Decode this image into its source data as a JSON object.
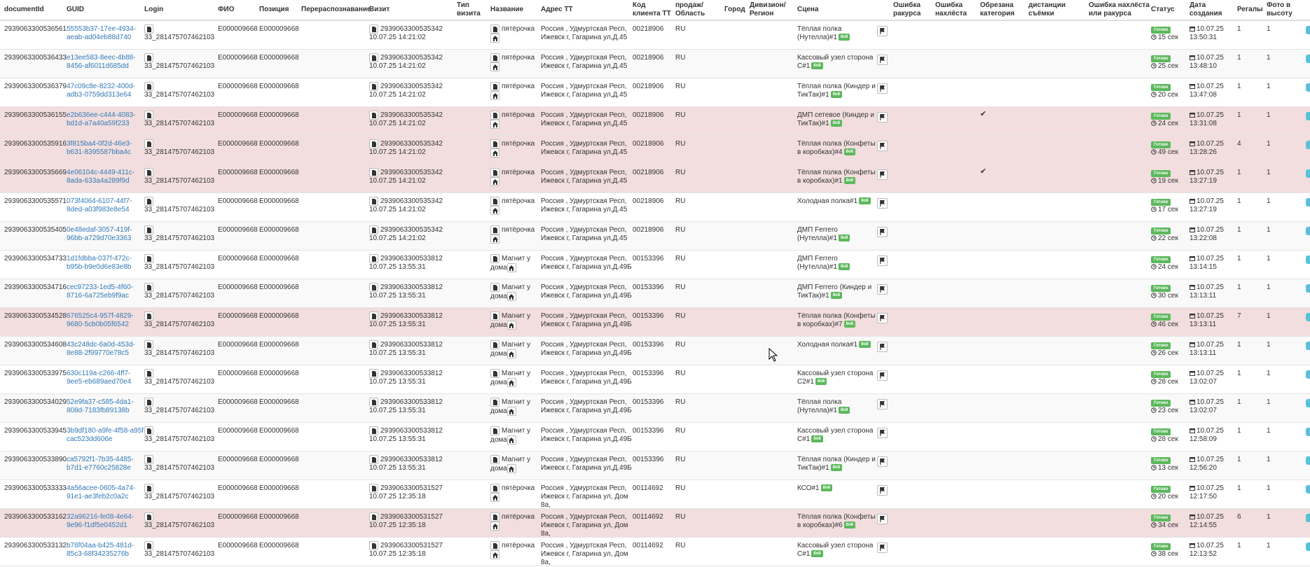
{
  "columns": [
    "documentId",
    "GUID",
    "Login",
    "ФИО",
    "Позиция",
    "Перераспознавание",
    "Визит",
    "Тип визита",
    "Название",
    "Адрес ТТ",
    "Код клиента ТТ",
    "продаж/ Область",
    "Город",
    "Дивизион/ Регион",
    "Сцена",
    "Ошибка ракурса",
    "Ошибка нахлёста",
    "Обрезана категория",
    "дистанции съёмки",
    "Ошибка нахлёста или ракурса",
    "Статус",
    "Дата создания",
    "Регалы",
    "Фото в высоту"
  ],
  "column_header_lines": {
    "Тип визита": [
      "Тип",
      "визита"
    ],
    "Код клиента ТТ": [
      "Код",
      "клиента ТТ"
    ],
    "продаж/ Область": [
      "продаж/",
      "Область"
    ],
    "Дивизион/ Регион": [
      "Дивизион/",
      "Регион"
    ],
    "Ошибка ракурса": [
      "Ошибка",
      "ракурса"
    ],
    "Ошибка нахлёста": [
      "Ошибка",
      "нахлёста"
    ],
    "Обрезана категория": [
      "Обрезана",
      "категория"
    ],
    "дистанции съёмки": [
      "дистанции",
      "съёмки"
    ],
    "Ошибка нахлёста или ракурса": [
      "Ошибка нахлёста",
      "или ракурса"
    ],
    "Дата создания": [
      "Дата",
      "создания"
    ],
    "Фото в высоту": [
      "Фото в",
      "высоту"
    ]
  },
  "badge_text": "8о8",
  "status_text": "Готово",
  "colors": {
    "link": "#337ab7",
    "highlight": "#f2dede",
    "badge": "#5cb85c",
    "edge": "#5bc0de"
  },
  "icons": {
    "file": "file-icon",
    "home": "home-icon",
    "flag": "flag-icon",
    "clock": "clock-icon",
    "calendar": "calendar-icon",
    "check": "check-icon"
  },
  "rows": [
    {
      "doc": "2939063300536561",
      "guid1": "55553b37-17ee-4934-",
      "guid2": "aeab-ad04eb88d740",
      "login": "33_281475707462103",
      "fio": "E000009668",
      "pos": "E000009668",
      "visit_id": "2939063300535342",
      "visit_dt": "10.07.25 14:21:02",
      "store": "пятёрочка",
      "store2": "",
      "addr1": "Россия , Удмуртская Респ,",
      "addr2": "Ижевск г, Гагарина ул,Д.45",
      "addr3": "",
      "code": "00218906",
      "region": "RU",
      "scene1": "Тёплая полка",
      "scene2": "(Нутелла)#1",
      "sec": "15 сек",
      "date": "10.07.25",
      "time": "13:50:31",
      "regaly": "1",
      "photo": "1",
      "hl": false,
      "check": false
    },
    {
      "doc": "2939063300536433",
      "guid1": "e13ee583-8eec-4b88-",
      "guid2": "8456-af6011d685dd",
      "login": "33_281475707462103",
      "fio": "E000009668",
      "pos": "E000009668",
      "visit_id": "2939063300535342",
      "visit_dt": "10.07.25 14:21:02",
      "store": "пятёрочка",
      "store2": "",
      "addr1": "Россия , Удмуртская Респ,",
      "addr2": "Ижевск г, Гагарина ул,Д.45",
      "addr3": "",
      "code": "00218906",
      "region": "RU",
      "scene1": "Кассовый узел сторона",
      "scene2": "С#1",
      "sec": "25 сек",
      "date": "10.07.25",
      "time": "13:48:10",
      "regaly": "1",
      "photo": "1",
      "hl": false,
      "check": false
    },
    {
      "doc": "2939063300536379",
      "guid1": "47c09c8e-8232-400d-",
      "guid2": "adb3-0759dd313e64",
      "login": "33_281475707462103",
      "fio": "E000009668",
      "pos": "E000009668",
      "visit_id": "2939063300535342",
      "visit_dt": "10.07.25 14:21:02",
      "store": "пятёрочка",
      "store2": "",
      "addr1": "Россия , Удмуртская Респ,",
      "addr2": "Ижевск г, Гагарина ул,Д.45",
      "addr3": "",
      "code": "00218906",
      "region": "RU",
      "scene1": "Тёплая полка (Киндер и",
      "scene2": "ТикТак)#1",
      "sec": "20 сек",
      "date": "10.07.25",
      "time": "13:47:08",
      "regaly": "1",
      "photo": "1",
      "hl": false,
      "check": false
    },
    {
      "doc": "2939063300536155",
      "guid1": "e2b636ee-c444-4083-",
      "guid2": "bd1d-a7a40a59f233",
      "login": "33_281475707462103",
      "fio": "E000009668",
      "pos": "E000009668",
      "visit_id": "2939063300535342",
      "visit_dt": "10.07.25 14:21:02",
      "store": "пятёрочка",
      "store2": "",
      "addr1": "Россия , Удмуртская Респ,",
      "addr2": "Ижевск г, Гагарина ул,Д.45",
      "addr3": "",
      "code": "00218906",
      "region": "RU",
      "scene1": "ДМП сетевое (Киндер и",
      "scene2": "ТикТак)#1",
      "sec": "24 сек",
      "date": "10.07.25",
      "time": "13:31:08",
      "regaly": "1",
      "photo": "1",
      "hl": true,
      "check": true
    },
    {
      "doc": "2939063300535916",
      "guid1": "3f815ba4-0f2d-46e3-",
      "guid2": "b631-8395587bba4c",
      "login": "33_281475707462103",
      "fio": "E000009668",
      "pos": "E000009668",
      "visit_id": "2939063300535342",
      "visit_dt": "10.07.25 14:21:02",
      "store": "пятёрочка",
      "store2": "",
      "addr1": "Россия , Удмуртская Респ,",
      "addr2": "Ижевск г, Гагарина ул,Д.45",
      "addr3": "",
      "code": "00218906",
      "region": "RU",
      "scene1": "Тёплая полка (Конфеты",
      "scene2": "в коробках)#4",
      "sec": "49 сек",
      "date": "10.07.25",
      "time": "13:28:26",
      "regaly": "4",
      "photo": "1",
      "hl": true,
      "check": false
    },
    {
      "doc": "2939063300535669",
      "guid1": "4e06104c-4449-411c-",
      "guid2": "8ada-633a4a289f9d",
      "login": "33_281475707462103",
      "fio": "E000009668",
      "pos": "E000009668",
      "visit_id": "2939063300535342",
      "visit_dt": "10.07.25 14:21:02",
      "store": "пятёрочка",
      "store2": "",
      "addr1": "Россия , Удмуртская Респ,",
      "addr2": "Ижевск г, Гагарина ул,Д.45",
      "addr3": "",
      "code": "00218906",
      "region": "RU",
      "scene1": "Тёплая полка (Конфеты",
      "scene2": "в коробках)#1",
      "sec": "19 сек",
      "date": "10.07.25",
      "time": "13:27:19",
      "regaly": "1",
      "photo": "1",
      "hl": true,
      "check": true
    },
    {
      "doc": "2939063300535571",
      "guid1": "073f4064-6107-44f7-",
      "guid2": "8ded-a03f983e8e54",
      "login": "33_281475707462103",
      "fio": "E000009668",
      "pos": "E000009668",
      "visit_id": "2939063300535342",
      "visit_dt": "10.07.25 14:21:02",
      "store": "пятёрочка",
      "store2": "",
      "addr1": "Россия , Удмуртская Респ,",
      "addr2": "Ижевск г, Гагарина ул,Д.45",
      "addr3": "",
      "code": "00218906",
      "region": "RU",
      "scene1": "Холодная полка#1",
      "scene2": "",
      "sec": "17 сек",
      "date": "10.07.25",
      "time": "13:27:19",
      "regaly": "1",
      "photo": "1",
      "hl": false,
      "check": false
    },
    {
      "doc": "2939063300535405",
      "guid1": "0e48edaf-3057-419f-",
      "guid2": "96bb-a729d70e3363",
      "login": "33_281475707462103",
      "fio": "E000009668",
      "pos": "E000009668",
      "visit_id": "2939063300535342",
      "visit_dt": "10.07.25 14:21:02",
      "store": "пятёрочка",
      "store2": "",
      "addr1": "Россия , Удмуртская Респ,",
      "addr2": "Ижевск г, Гагарина ул,Д.45",
      "addr3": "",
      "code": "00218906",
      "region": "RU",
      "scene1": "ДМП Ferrero",
      "scene2": "(Нутелла)#1",
      "sec": "22 сек",
      "date": "10.07.25",
      "time": "13:22:08",
      "regaly": "1",
      "photo": "1",
      "hl": false,
      "check": false
    },
    {
      "doc": "2939063300534733",
      "guid1": "1d1fdbba-037f-472c-",
      "guid2": "b95b-b9e0d6e83e8b",
      "login": "33_281475707462103",
      "fio": "E000009668",
      "pos": "E000009668",
      "visit_id": "2939063300533812",
      "visit_dt": "10.07.25 13:55:31",
      "store": "Магнит у",
      "store2": "дома",
      "addr1": "Россия , Удмуртская Респ,",
      "addr2": "Ижевск г, Гагарина ул,Д.49Б",
      "addr3": "",
      "code": "00153396",
      "region": "RU",
      "scene1": "ДМП Ferrero",
      "scene2": "(Нутелла)#1",
      "sec": "24 сек",
      "date": "10.07.25",
      "time": "13:14:15",
      "regaly": "1",
      "photo": "1",
      "hl": false,
      "check": false
    },
    {
      "doc": "2939063300534716",
      "guid1": "cec97233-1ed5-4f60-",
      "guid2": "8716-6a725eb9f9ac",
      "login": "33_281475707462103",
      "fio": "E000009668",
      "pos": "E000009668",
      "visit_id": "2939063300533812",
      "visit_dt": "10.07.25 13:55:31",
      "store": "Магнит у",
      "store2": "дома",
      "addr1": "Россия , Удмуртская Респ,",
      "addr2": "Ижевск г, Гагарина ул,Д.49Б",
      "addr3": "",
      "code": "00153396",
      "region": "RU",
      "scene1": "ДМП Ferrero (Киндер и",
      "scene2": "ТикТак)#1",
      "sec": "30 сек",
      "date": "10.07.25",
      "time": "13:13:11",
      "regaly": "1",
      "photo": "1",
      "hl": false,
      "check": false
    },
    {
      "doc": "2939063300534528",
      "guid1": "676525c4-957f-4829-",
      "guid2": "9680-5cb0b05f6542",
      "login": "33_281475707462103",
      "fio": "E000009668",
      "pos": "E000009668",
      "visit_id": "2939063300533812",
      "visit_dt": "10.07.25 13:55:31",
      "store": "Магнит у",
      "store2": "дома",
      "addr1": "Россия , Удмуртская Респ,",
      "addr2": "Ижевск г, Гагарина ул,Д.49Б",
      "addr3": "",
      "code": "00153396",
      "region": "RU",
      "scene1": "Тёплая полка (Конфеты",
      "scene2": "в коробках)#7",
      "sec": "46 сек",
      "date": "10.07.25",
      "time": "13:13:11",
      "regaly": "7",
      "photo": "1",
      "hl": true,
      "check": false
    },
    {
      "doc": "2939063300534608",
      "guid1": "43c248dc-6a0d-453d-",
      "guid2": "8e88-2f99770e78c5",
      "login": "33_281475707462103",
      "fio": "E000009668",
      "pos": "E000009668",
      "visit_id": "2939063300533812",
      "visit_dt": "10.07.25 13:55:31",
      "store": "Магнит у",
      "store2": "дома",
      "addr1": "Россия , Удмуртская Респ,",
      "addr2": "Ижевск г, Гагарина ул,Д.49Б",
      "addr3": "",
      "code": "00153396",
      "region": "RU",
      "scene1": "Холодная полка#1",
      "scene2": "",
      "sec": "26 сек",
      "date": "10.07.25",
      "time": "13:13:11",
      "regaly": "1",
      "photo": "1",
      "hl": false,
      "check": false
    },
    {
      "doc": "2939063300533975",
      "guid1": "630c119a-c266-4ff7-",
      "guid2": "9ee5-eb689aed70e4",
      "login": "33_281475707462103",
      "fio": "E000009668",
      "pos": "E000009668",
      "visit_id": "2939063300533812",
      "visit_dt": "10.07.25 13:55:31",
      "store": "Магнит у",
      "store2": "дома",
      "addr1": "Россия , Удмуртская Респ,",
      "addr2": "Ижевск г, Гагарина ул,Д.49Б",
      "addr3": "",
      "code": "00153396",
      "region": "RU",
      "scene1": "Кассовый узел сторона",
      "scene2": "С2#1",
      "sec": "28 сек",
      "date": "10.07.25",
      "time": "13:02:07",
      "regaly": "1",
      "photo": "1",
      "hl": false,
      "check": false
    },
    {
      "doc": "2939063300534029",
      "guid1": "52e9fa37-c585-4da1-",
      "guid2": "808d-7183fb89138b",
      "login": "33_281475707462103",
      "fio": "E000009668",
      "pos": "E000009668",
      "visit_id": "2939063300533812",
      "visit_dt": "10.07.25 13:55:31",
      "store": "Магнит у",
      "store2": "дома",
      "addr1": "Россия , Удмуртская Респ,",
      "addr2": "Ижевск г, Гагарина ул,Д.49Б",
      "addr3": "",
      "code": "00153396",
      "region": "RU",
      "scene1": "Тёплая полка",
      "scene2": "(Нутелла)#1",
      "sec": "23 сек",
      "date": "10.07.25",
      "time": "13:02:07",
      "regaly": "1",
      "photo": "1",
      "hl": false,
      "check": false
    },
    {
      "doc": "2939063300533945",
      "guid1": "3b9df180-a9fe-4f58-a95f-",
      "guid2": "cac523dd606e",
      "login": "33_281475707462103",
      "fio": "E000009668",
      "pos": "E000009668",
      "visit_id": "2939063300533812",
      "visit_dt": "10.07.25 13:55:31",
      "store": "Магнит у",
      "store2": "дома",
      "addr1": "Россия , Удмуртская Респ,",
      "addr2": "Ижевск г, Гагарина ул,Д.49Б",
      "addr3": "",
      "code": "00153396",
      "region": "RU",
      "scene1": "Кассовый узел сторона",
      "scene2": "С#1",
      "sec": "28 сек",
      "date": "10.07.25",
      "time": "12:58:09",
      "regaly": "1",
      "photo": "1",
      "hl": false,
      "check": false
    },
    {
      "doc": "2939063300533890",
      "guid1": "ca5792f1-7b35-4485-",
      "guid2": "b7d1-e7760c25828e",
      "login": "33_281475707462103",
      "fio": "E000009668",
      "pos": "E000009668",
      "visit_id": "2939063300533812",
      "visit_dt": "10.07.25 13:55:31",
      "store": "Магнит у",
      "store2": "дома",
      "addr1": "Россия , Удмуртская Респ,",
      "addr2": "Ижевск г, Гагарина ул,Д.49Б",
      "addr3": "",
      "code": "00153396",
      "region": "RU",
      "scene1": "Тёплая полка (Киндер и",
      "scene2": "ТикТак)#1",
      "sec": "13 сек",
      "date": "10.07.25",
      "time": "12:56:20",
      "regaly": "1",
      "photo": "1",
      "hl": false,
      "check": false
    },
    {
      "doc": "2939063300533333",
      "guid1": "4a56acee-0605-4a74-",
      "guid2": "91e1-ae3feb2c0a2c",
      "login": "33_281475707462103",
      "fio": "E000009668",
      "pos": "E000009668",
      "visit_id": "2939063300531527",
      "visit_dt": "10.07.25 12:35:18",
      "store": "пятёрочка",
      "store2": "",
      "addr1": "Россия , Удмуртская Респ,",
      "addr2": "Ижевск г, Гагарина ул, Дом",
      "addr3": "8а,",
      "code": "00114692",
      "region": "RU",
      "scene1": "КСО#1",
      "scene2": "",
      "sec": "20 сек",
      "date": "10.07.25",
      "time": "12:17:50",
      "regaly": "1",
      "photo": "1",
      "hl": false,
      "check": false
    },
    {
      "doc": "2939063300533162",
      "guid1": "32a96216-fe08-4e64-",
      "guid2": "9e96-f1df5e0452d1",
      "login": "33_281475707462103",
      "fio": "E000009668",
      "pos": "E000009668",
      "visit_id": "2939063300531527",
      "visit_dt": "10.07.25 12:35:18",
      "store": "пятёрочка",
      "store2": "",
      "addr1": "Россия , Удмуртская Респ,",
      "addr2": "Ижевск г, Гагарина ул, Дом",
      "addr3": "8а,",
      "code": "00114692",
      "region": "RU",
      "scene1": "Тёплая полка (Конфеты",
      "scene2": "в коробках)#6",
      "sec": "34 сек",
      "date": "10.07.25",
      "time": "12:14:55",
      "regaly": "6",
      "photo": "1",
      "hl": true,
      "check": false
    },
    {
      "doc": "2939063300533132",
      "guid1": "b76f04aa-b425-481d-",
      "guid2": "85c3-68f34235276b",
      "login": "33_281475707462103",
      "fio": "E000009668",
      "pos": "E000009668",
      "visit_id": "2939063300531527",
      "visit_dt": "10.07.25 12:35:18",
      "store": "пятёрочка",
      "store2": "",
      "addr1": "Россия , Удмуртская Респ,",
      "addr2": "Ижевск г, Гагарина ул, Дом",
      "addr3": "8а,",
      "code": "00114692",
      "region": "RU",
      "scene1": "Кассовый узел сторона",
      "scene2": "С#1",
      "sec": "38 сек",
      "date": "10.07.25",
      "time": "12:13:52",
      "regaly": "1",
      "photo": "1",
      "hl": false,
      "check": false
    }
  ]
}
